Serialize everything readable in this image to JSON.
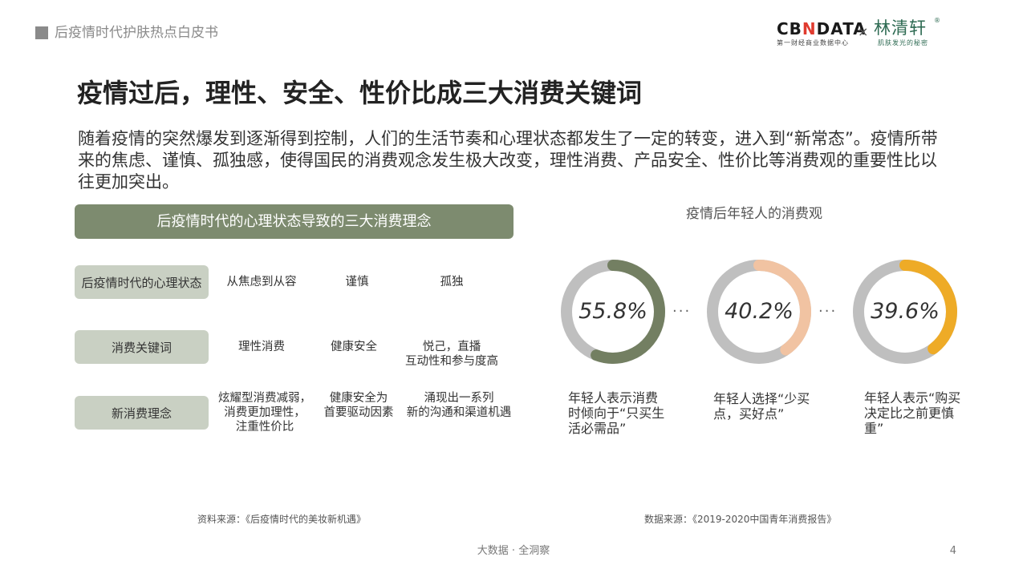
{
  "header": {
    "report_title": "后疫情时代护肤热点白皮书",
    "logo_cbn_pre": "CB",
    "logo_cbn_n": "N",
    "logo_cbn_post": "DATA",
    "logo_cbn_sub": "第一财经商业数据中心",
    "logo_times": "×",
    "logo_lqx": "林清轩",
    "logo_lqx_reg": "®",
    "logo_lqx_sub": "肌肤发光的秘密"
  },
  "title": "疫情过后，理性、安全、性价比成三大消费关键词",
  "intro": "随着疫情的突然爆发到逐渐得到控制，人们的生活节奏和心理状态都发生了一定的转变，进入到“新常态”。疫情所带来的焦虑、谨慎、孤独感，使得国民的消费观念发生极大改变，理性消费、产品安全、性价比等消费观的重要性比以往更加突出。",
  "table": {
    "banner": "后疫情时代的心理状态导致的三大消费理念",
    "rows": [
      {
        "label": "后疫情时代的心理状态",
        "cells": [
          "从焦虑到从容",
          "谨慎",
          "孤独"
        ]
      },
      {
        "label": "消费关键词",
        "cells": [
          "理性消费",
          "健康安全",
          "悦己，直播\n互动性和参与度高"
        ]
      },
      {
        "label": "新消费理念",
        "cells": [
          "炫耀型消费减弱，\n消费更加理性，\n注重性价比",
          "健康安全为\n首要驱动因素",
          "涌现出一系列\n新的沟通和渠道机遇"
        ]
      }
    ],
    "source": "资料来源：《后疫情时代的美妆新机遇》"
  },
  "consumption": {
    "title": "疫情后年轻人的消费观",
    "dots": "···",
    "items": [
      {
        "value": 55.8,
        "label": "55.8%",
        "color": "#737f62",
        "caption": "年轻人表示消费时倾向于“只买生活必需品”"
      },
      {
        "value": 40.2,
        "label": "40.2%",
        "color": "#f1c3a2",
        "caption": "年轻人选择“少买点，买好点”"
      },
      {
        "value": 39.6,
        "label": "39.6%",
        "color": "#eeab27",
        "caption": "年轻人表示“购买决定比之前更慎重”"
      }
    ],
    "track_color": "#bfbfbf",
    "source": "数据来源：《2019-2020中国青年消费报告》"
  },
  "footer": {
    "tagline": "大数据 · 全洞察",
    "page": "4"
  }
}
